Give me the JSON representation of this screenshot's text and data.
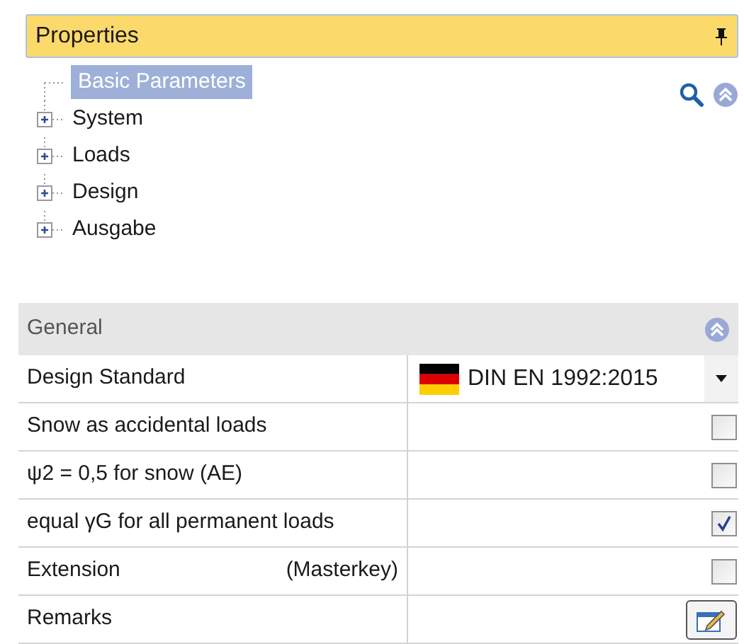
{
  "panel": {
    "title": "Properties"
  },
  "tree": [
    {
      "label": "Basic Parameters",
      "selected": true,
      "expandable": false
    },
    {
      "label": "System",
      "selected": false,
      "expandable": true
    },
    {
      "label": "Loads",
      "selected": false,
      "expandable": true
    },
    {
      "label": "Design",
      "selected": false,
      "expandable": true
    },
    {
      "label": "Ausgabe",
      "selected": false,
      "expandable": true
    }
  ],
  "section": {
    "title": "General"
  },
  "rows": [
    {
      "kind": "dropdown",
      "label": "Design Standard",
      "value": "DIN EN 1992:2015"
    },
    {
      "kind": "checkbox",
      "label": "Snow as accidental loads",
      "checked": false
    },
    {
      "kind": "checkbox",
      "label": "ψ2 = 0,5 for snow (AE)",
      "checked": false
    },
    {
      "kind": "checkbox",
      "label": "equal γG for all permanent loads",
      "checked": true
    },
    {
      "kind": "checkbox",
      "label": "Extension",
      "note": "(Masterkey)",
      "checked": false
    },
    {
      "kind": "button",
      "label": "Remarks"
    }
  ]
}
